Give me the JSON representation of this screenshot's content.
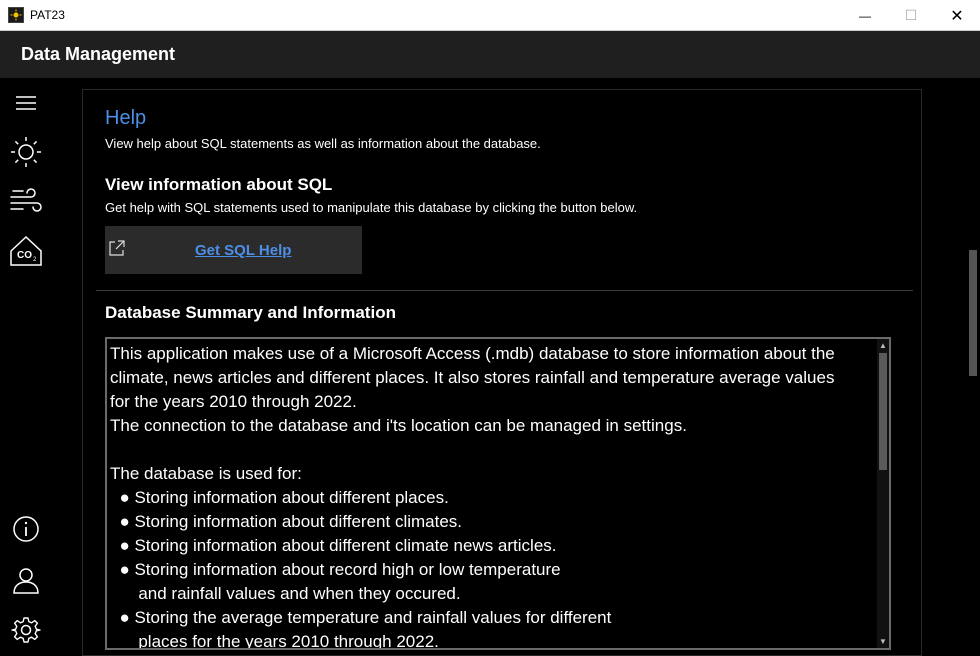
{
  "window": {
    "title": "PAT23",
    "minimize_glyph": "—",
    "maximize_glyph": "☐",
    "close_glyph": "✕"
  },
  "header": {
    "title": "Data Management"
  },
  "nav": {
    "icons": [
      "menu-icon",
      "sun-icon",
      "wind-icon",
      "co2-icon",
      "info-icon",
      "user-icon",
      "gear-icon"
    ]
  },
  "help": {
    "title": "Help",
    "description": "View help about SQL statements as well as information about the database."
  },
  "sql": {
    "heading": "View information about SQL",
    "description": "Get help with SQL statements  used to manipulate this database by clicking the button below.",
    "button_label": "Get SQL Help"
  },
  "database": {
    "heading": "Database Summary and Information",
    "summary_text": "This application makes use of a Microsoft Access (.mdb) database to store information about the\nclimate, news articles and different places. It also stores rainfall and temperature average values\nfor the years 2010 through 2022.\nThe connection to the database and i'ts location can be managed in settings.\n\nThe database is used for:\n  ● Storing information about different places.\n  ● Storing information about different climates.\n  ● Storing information about different climate news articles.\n  ● Storing information about record high or low temperature\n      and rainfall values and when they occured.\n  ● Storing the average temperature and rainfall values for different\n      places for the years 2010 through 2022."
  },
  "colors": {
    "accent": "#4d8fe6",
    "header_bg": "#1f1f1f",
    "button_bg": "#2b2b2b"
  }
}
